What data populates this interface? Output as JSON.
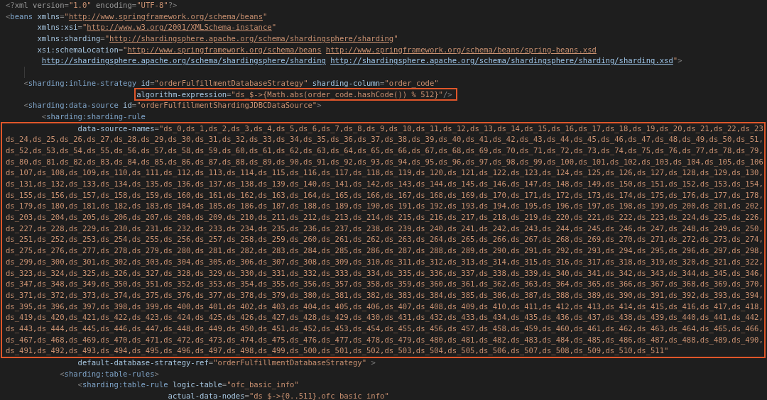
{
  "editor": {
    "blocks": [
      {
        "kind": "plain",
        "lines": [
          {
            "tokens": [
              {
                "kind": "punct",
                "s": "<?"
              },
              {
                "kind": "decl",
                "s": "xml version"
              },
              {
                "kind": "punct",
                "s": "="
              },
              {
                "kind": "str",
                "s": "\"1.0\""
              },
              {
                "kind": "decl",
                "s": " encoding"
              },
              {
                "kind": "punct",
                "s": "="
              },
              {
                "kind": "str",
                "s": "\"UTF-8\""
              },
              {
                "kind": "punct",
                "s": "?>"
              }
            ]
          },
          {
            "tokens": [
              {
                "kind": "punct",
                "s": "<"
              },
              {
                "kind": "tag",
                "s": "beans"
              },
              {
                "kind": "attr",
                "s": " xmlns"
              },
              {
                "kind": "punct",
                "s": "="
              },
              {
                "kind": "str",
                "s": "\""
              },
              {
                "kind": "url",
                "s": "http://www.springframework.org/schema/beans"
              },
              {
                "kind": "str",
                "s": "\""
              }
            ]
          },
          {
            "tokens": [
              {
                "kind": "attr",
                "s": "       xmlns:xsi"
              },
              {
                "kind": "punct",
                "s": "="
              },
              {
                "kind": "str",
                "s": "\""
              },
              {
                "kind": "url",
                "s": "http://www.w3.org/2001/XMLSchema-instance"
              },
              {
                "kind": "str",
                "s": "\""
              }
            ]
          },
          {
            "tokens": [
              {
                "kind": "attr",
                "s": "       xmlns:sharding"
              },
              {
                "kind": "punct",
                "s": "="
              },
              {
                "kind": "str",
                "s": "\""
              },
              {
                "kind": "url",
                "s": "http://shardingsphere.apache.org/schema/shardingsphere/sharding"
              },
              {
                "kind": "str",
                "s": "\""
              }
            ]
          },
          {
            "tokens": [
              {
                "kind": "attr",
                "s": "       xsi:schemaLocation"
              },
              {
                "kind": "punct",
                "s": "="
              },
              {
                "kind": "str",
                "s": "\""
              },
              {
                "kind": "url",
                "s": "http://www.springframework.org/schema/beans"
              },
              {
                "kind": "url_spaced",
                "s": "http://www.springframework.org/schema/beans/spring-beans.xsd"
              }
            ]
          },
          {
            "tokens": [
              {
                "kind": "link",
                "s": "        http://shardingsphere.apache.org/schema/shardingsphere/sharding"
              },
              {
                "kind": "link_spaced",
                "s": "http://shardingsphere.apache.org/schema/shardingsphere/sharding/sharding.xsd"
              },
              {
                "kind": "str",
                "s": "\""
              },
              {
                "kind": "punct",
                "s": ">"
              }
            ]
          },
          {
            "kind": "blank"
          },
          {
            "tokens": [
              {
                "kind": "punct",
                "s": "    <"
              },
              {
                "kind": "tag",
                "s": "sharding:inline-strategy"
              },
              {
                "kind": "attr",
                "s": " id"
              },
              {
                "kind": "punct",
                "s": "="
              },
              {
                "kind": "str",
                "s": "\"orderFulfillmentDatabaseStrategy\""
              },
              {
                "kind": "attr",
                "s": " sharding-column"
              },
              {
                "kind": "punct",
                "s": "="
              },
              {
                "kind": "str",
                "s": "\"order_code\""
              }
            ]
          }
        ]
      },
      {
        "kind": "inline_frame",
        "lines": [
          {
            "tokens": [
              {
                "kind": "attr",
                "s": "                             algorithm-expression"
              },
              {
                "kind": "punct",
                "s": "="
              },
              {
                "kind": "str",
                "s": "\"ds_$->{Math.abs(order_code.hashCode()) % 512}\""
              },
              {
                "kind": "punct",
                "s": "/>"
              }
            ]
          }
        ]
      },
      {
        "kind": "plain",
        "lines": [
          {
            "tokens": [
              {
                "kind": "punct",
                "s": "    <"
              },
              {
                "kind": "tag",
                "s": "sharding:data-source"
              },
              {
                "kind": "attr",
                "s": " id"
              },
              {
                "kind": "punct",
                "s": "="
              },
              {
                "kind": "str",
                "s": "\"orderFulfillmentShardingJDBCDataSource\""
              },
              {
                "kind": "punct",
                "s": ">"
              }
            ]
          },
          {
            "tokens": [
              {
                "kind": "punct",
                "s": "        <"
              },
              {
                "kind": "tag",
                "s": "sharding:sharding-rule"
              }
            ]
          }
        ]
      },
      {
        "kind": "full_frame",
        "lines": [
          {
            "tokens": [
              {
                "kind": "attr",
                "s": "                data-source-names"
              },
              {
                "kind": "punct",
                "s": "="
              },
              {
                "kind": "str",
                "s": "\"ds_0,ds_1,ds_2,ds_3,ds_4,ds_5,ds_6,ds_7,ds_8,ds_9,ds_10,ds_11,ds_12,ds_13,ds_14,ds_15,ds_16,ds_17,ds_18,ds_19,ds_20,ds_21,ds_22,ds_23"
              }
            ]
          },
          {
            "tokens": [
              {
                "kind": "str",
                "s": "ds_24,ds_25,ds_26,ds_27,ds_28,ds_29,ds_30,ds_31,ds_32,ds_33,ds_34,ds_35,ds_36,ds_37,ds_38,ds_39,ds_40,ds_41,ds_42,ds_43,ds_44,ds_45,ds_46,ds_47,ds_48,ds_49,ds_50,ds_51,"
              }
            ]
          },
          {
            "tokens": [
              {
                "kind": "str",
                "s": "ds_52,ds_53,ds_54,ds_55,ds_56,ds_57,ds_58,ds_59,ds_60,ds_61,ds_62,ds_63,ds_64,ds_65,ds_66,ds_67,ds_68,ds_69,ds_70,ds_71,ds_72,ds_73,ds_74,ds_75,ds_76,ds_77,ds_78,ds_79,"
              }
            ]
          },
          {
            "tokens": [
              {
                "kind": "str",
                "s": "ds_80,ds_81,ds_82,ds_83,ds_84,ds_85,ds_86,ds_87,ds_88,ds_89,ds_90,ds_91,ds_92,ds_93,ds_94,ds_95,ds_96,ds_97,ds_98,ds_99,ds_100,ds_101,ds_102,ds_103,ds_104,ds_105,ds_106"
              }
            ]
          },
          {
            "tokens": [
              {
                "kind": "str",
                "s": "ds_107,ds_108,ds_109,ds_110,ds_111,ds_112,ds_113,ds_114,ds_115,ds_116,ds_117,ds_118,ds_119,ds_120,ds_121,ds_122,ds_123,ds_124,ds_125,ds_126,ds_127,ds_128,ds_129,ds_130,"
              }
            ]
          },
          {
            "tokens": [
              {
                "kind": "str",
                "s": "ds_131,ds_132,ds_133,ds_134,ds_135,ds_136,ds_137,ds_138,ds_139,ds_140,ds_141,ds_142,ds_143,ds_144,ds_145,ds_146,ds_147,ds_148,ds_149,ds_150,ds_151,ds_152,ds_153,ds_154,"
              }
            ]
          },
          {
            "tokens": [
              {
                "kind": "str",
                "s": "ds_155,ds_156,ds_157,ds_158,ds_159,ds_160,ds_161,ds_162,ds_163,ds_164,ds_165,ds_166,ds_167,ds_168,ds_169,ds_170,ds_171,ds_172,ds_173,ds_174,ds_175,ds_176,ds_177,ds_178,"
              }
            ]
          },
          {
            "tokens": [
              {
                "kind": "str",
                "s": "ds_179,ds_180,ds_181,ds_182,ds_183,ds_184,ds_185,ds_186,ds_187,ds_188,ds_189,ds_190,ds_191,ds_192,ds_193,ds_194,ds_195,ds_196,ds_197,ds_198,ds_199,ds_200,ds_201,ds_202,"
              }
            ]
          },
          {
            "tokens": [
              {
                "kind": "str",
                "s": "ds_203,ds_204,ds_205,ds_206,ds_207,ds_208,ds_209,ds_210,ds_211,ds_212,ds_213,ds_214,ds_215,ds_216,ds_217,ds_218,ds_219,ds_220,ds_221,ds_222,ds_223,ds_224,ds_225,ds_226,"
              }
            ]
          },
          {
            "tokens": [
              {
                "kind": "str",
                "s": "ds_227,ds_228,ds_229,ds_230,ds_231,ds_232,ds_233,ds_234,ds_235,ds_236,ds_237,ds_238,ds_239,ds_240,ds_241,ds_242,ds_243,ds_244,ds_245,ds_246,ds_247,ds_248,ds_249,ds_250,"
              }
            ]
          },
          {
            "tokens": [
              {
                "kind": "str",
                "s": "ds_251,ds_252,ds_253,ds_254,ds_255,ds_256,ds_257,ds_258,ds_259,ds_260,ds_261,ds_262,ds_263,ds_264,ds_265,ds_266,ds_267,ds_268,ds_269,ds_270,ds_271,ds_272,ds_273,ds_274,"
              }
            ]
          },
          {
            "tokens": [
              {
                "kind": "str",
                "s": "ds_275,ds_276,ds_277,ds_278,ds_279,ds_280,ds_281,ds_282,ds_283,ds_284,ds_285,ds_286,ds_287,ds_288,ds_289,ds_290,ds_291,ds_292,ds_293,ds_294,ds_295,ds_296,ds_297,ds_298,"
              }
            ]
          },
          {
            "tokens": [
              {
                "kind": "str",
                "s": "ds_299,ds_300,ds_301,ds_302,ds_303,ds_304,ds_305,ds_306,ds_307,ds_308,ds_309,ds_310,ds_311,ds_312,ds_313,ds_314,ds_315,ds_316,ds_317,ds_318,ds_319,ds_320,ds_321,ds_322,"
              }
            ]
          },
          {
            "tokens": [
              {
                "kind": "str",
                "s": "ds_323,ds_324,ds_325,ds_326,ds_327,ds_328,ds_329,ds_330,ds_331,ds_332,ds_333,ds_334,ds_335,ds_336,ds_337,ds_338,ds_339,ds_340,ds_341,ds_342,ds_343,ds_344,ds_345,ds_346,"
              }
            ]
          },
          {
            "tokens": [
              {
                "kind": "str",
                "s": "ds_347,ds_348,ds_349,ds_350,ds_351,ds_352,ds_353,ds_354,ds_355,ds_356,ds_357,ds_358,ds_359,ds_360,ds_361,ds_362,ds_363,ds_364,ds_365,ds_366,ds_367,ds_368,ds_369,ds_370,"
              }
            ]
          },
          {
            "tokens": [
              {
                "kind": "str",
                "s": "ds_371,ds_372,ds_373,ds_374,ds_375,ds_376,ds_377,ds_378,ds_379,ds_380,ds_381,ds_382,ds_383,ds_384,ds_385,ds_386,ds_387,ds_388,ds_389,ds_390,ds_391,ds_392,ds_393,ds_394,"
              }
            ]
          },
          {
            "tokens": [
              {
                "kind": "str",
                "s": "ds_395,ds_396,ds_397,ds_398,ds_399,ds_400,ds_401,ds_402,ds_403,ds_404,ds_405,ds_406,ds_407,ds_408,ds_409,ds_410,ds_411,ds_412,ds_413,ds_414,ds_415,ds_416,ds_417,ds_418,"
              }
            ]
          },
          {
            "tokens": [
              {
                "kind": "str",
                "s": "ds_419,ds_420,ds_421,ds_422,ds_423,ds_424,ds_425,ds_426,ds_427,ds_428,ds_429,ds_430,ds_431,ds_432,ds_433,ds_434,ds_435,ds_436,ds_437,ds_438,ds_439,ds_440,ds_441,ds_442,"
              }
            ]
          },
          {
            "tokens": [
              {
                "kind": "str",
                "s": "ds_443,ds_444,ds_445,ds_446,ds_447,ds_448,ds_449,ds_450,ds_451,ds_452,ds_453,ds_454,ds_455,ds_456,ds_457,ds_458,ds_459,ds_460,ds_461,ds_462,ds_463,ds_464,ds_465,ds_466,"
              }
            ]
          },
          {
            "tokens": [
              {
                "kind": "str",
                "s": "ds_467,ds_468,ds_469,ds_470,ds_471,ds_472,ds_473,ds_474,ds_475,ds_476,ds_477,ds_478,ds_479,ds_480,ds_481,ds_482,ds_483,ds_484,ds_485,ds_486,ds_487,ds_488,ds_489,ds_490,"
              }
            ]
          },
          {
            "tokens": [
              {
                "kind": "str",
                "s": "ds_491,ds_492,ds_493,ds_494,ds_495,ds_496,ds_497,ds_498,ds_499,ds_500,ds_501,ds_502,ds_503,ds_504,ds_505,ds_506,ds_507,ds_508,ds_509,ds_510,ds_511\""
              }
            ]
          }
        ]
      },
      {
        "kind": "plain",
        "lines": [
          {
            "tokens": [
              {
                "kind": "attr",
                "s": "                default-database-strategy-ref"
              },
              {
                "kind": "punct",
                "s": "="
              },
              {
                "kind": "str",
                "s": "\"orderFulfillmentDatabaseStrategy\""
              },
              {
                "kind": "punct",
                "s": " >"
              }
            ]
          },
          {
            "tokens": [
              {
                "kind": "punct",
                "s": "            <"
              },
              {
                "kind": "tag",
                "s": "sharding:table-rules"
              },
              {
                "kind": "punct",
                "s": ">"
              }
            ]
          },
          {
            "tokens": [
              {
                "kind": "punct",
                "s": "                <"
              },
              {
                "kind": "tag",
                "s": "sharding:table-rule"
              },
              {
                "kind": "attr",
                "s": " logic-table"
              },
              {
                "kind": "punct",
                "s": "="
              },
              {
                "kind": "str",
                "s": "\"ofc_basic_info\""
              }
            ]
          },
          {
            "tokens": [
              {
                "kind": "attr",
                "s": "                                    actual-data-nodes"
              },
              {
                "kind": "punct",
                "s": "="
              },
              {
                "kind": "str",
                "s": "\"ds_$->{0..511}.ofc_basic_info\""
              }
            ]
          }
        ]
      }
    ]
  }
}
